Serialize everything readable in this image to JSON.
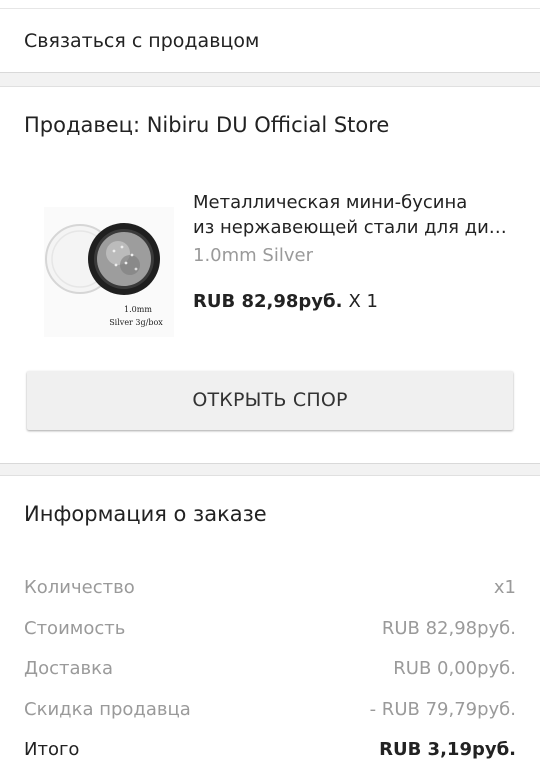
{
  "contact_seller": {
    "label": "Связаться с продавцом"
  },
  "seller": {
    "title": "Продавец: Nibiru DU Official Store"
  },
  "product": {
    "title_line1": "Металлическая мини-бусина",
    "title_line2": "из нержавеющей стали для ди…",
    "variant": "1.0mm Silver",
    "price": "RUB 82,98руб.",
    "quantity": "X 1",
    "image_caption_line1": "1.0mm",
    "image_caption_line2": "Silver 3g/box"
  },
  "dispute_button": {
    "label": "ОТКРЫТЬ СПОР"
  },
  "order_info": {
    "title": "Информация о заказе",
    "rows": [
      {
        "label": "Количество",
        "value": "x1"
      },
      {
        "label": "Стоимость",
        "value": "RUB 82,98руб."
      },
      {
        "label": "Доставка",
        "value": "RUB 0,00руб."
      },
      {
        "label": "Скидка продавца",
        "value": "- RUB 79,79руб."
      },
      {
        "label": "Итого",
        "value": "RUB 3,19руб."
      }
    ]
  },
  "colors": {
    "background": "#f2f2f2",
    "card": "#ffffff",
    "muted_text": "#9a9a9a",
    "text": "#222222",
    "button_bg": "#f0f0f0"
  }
}
